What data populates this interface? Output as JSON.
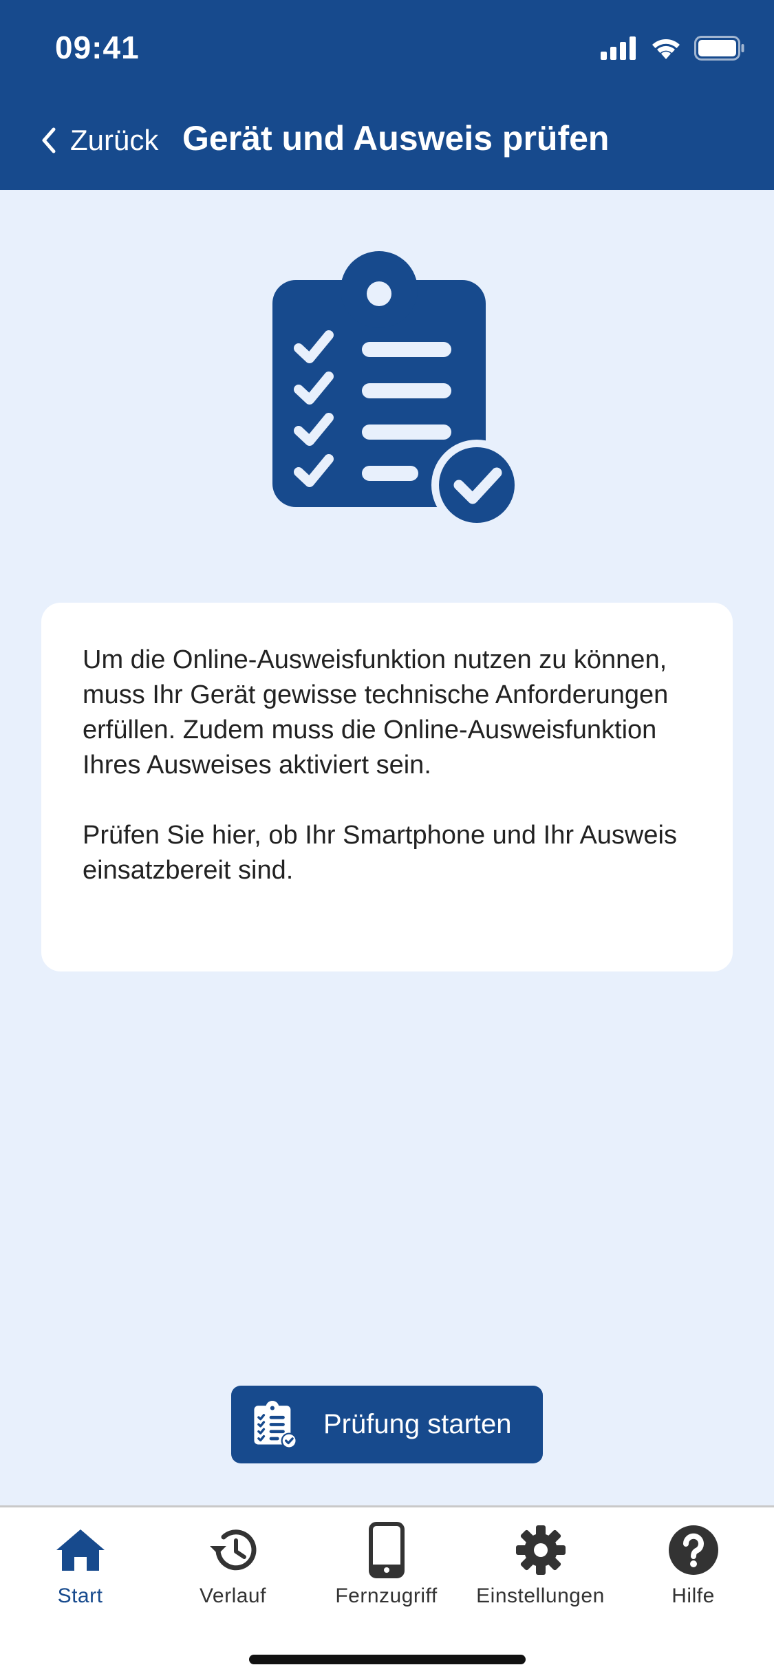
{
  "status_bar": {
    "time": "09:41",
    "icons": [
      "signal-icon",
      "wifi-icon",
      "battery-icon"
    ]
  },
  "header": {
    "back_label": "Zurück",
    "title": "Gerät und Ausweis prüfen"
  },
  "illustration": {
    "icon": "clipboard-check-icon"
  },
  "info_card": {
    "paragraph_1": "Um die Online-Ausweisfunktion nutzen zu können, muss Ihr Gerät gewisse technische Anforderungen erfüllen. Zudem muss die Online-Ausweisfunktion Ihres Ausweises aktiviert sein.",
    "paragraph_2": "Prüfen Sie hier, ob Ihr Smartphone und Ihr Ausweis einsatzbereit sind."
  },
  "start_button": {
    "label": "Prüfung starten",
    "icon": "clipboard-check-icon"
  },
  "tab_bar": {
    "items": [
      {
        "label": "Start",
        "icon": "home-icon",
        "active": true
      },
      {
        "label": "Verlauf",
        "icon": "history-icon",
        "active": false
      },
      {
        "label": "Fernzugriff",
        "icon": "smartphone-icon",
        "active": false
      },
      {
        "label": "Einstellungen",
        "icon": "gear-icon",
        "active": false
      },
      {
        "label": "Hilfe",
        "icon": "help-icon",
        "active": false
      }
    ]
  },
  "colors": {
    "brand": "#174a8d",
    "background": "#e8f0fc",
    "card": "#ffffff",
    "text": "#222222",
    "tab_inactive": "#333333"
  }
}
